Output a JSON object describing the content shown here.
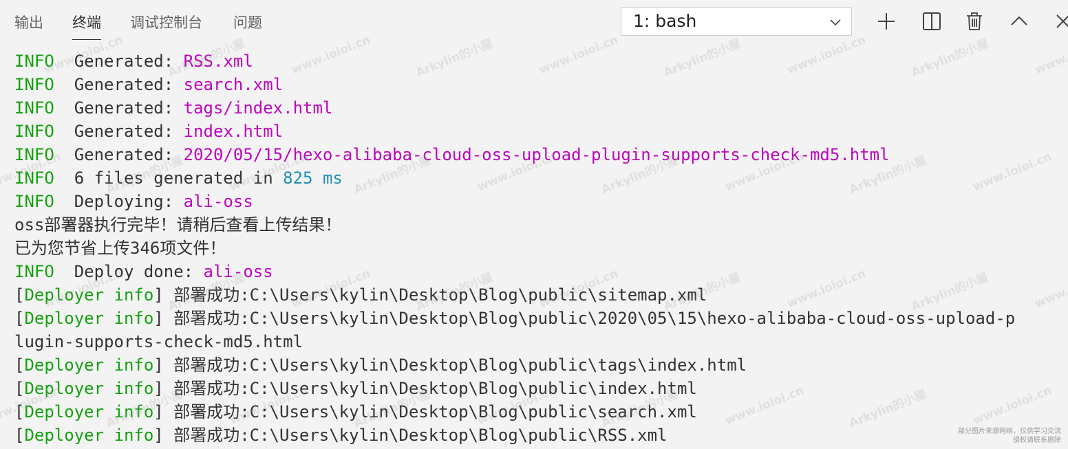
{
  "panel": {
    "tabs": [
      {
        "label": "输出",
        "active": false
      },
      {
        "label": "终端",
        "active": true
      },
      {
        "label": "调试控制台",
        "active": false
      },
      {
        "label": "问题",
        "active": false
      }
    ],
    "terminal_select": {
      "value": "1: bash"
    },
    "actions": [
      {
        "name": "new-terminal",
        "icon": "plus-icon"
      },
      {
        "name": "split-terminal",
        "icon": "split-icon"
      },
      {
        "name": "kill-terminal",
        "icon": "trash-icon"
      },
      {
        "name": "maximize-panel",
        "icon": "chevron-up-icon"
      },
      {
        "name": "close-panel",
        "icon": "close-icon"
      }
    ]
  },
  "colors": {
    "info": "#13a10e",
    "path": "#bc05bc",
    "number": "#1f8fb4",
    "text": "#333333",
    "background": "#f3f3f3"
  },
  "terminal": {
    "lines": [
      [
        {
          "t": "INFO",
          "c": "info"
        },
        {
          "t": "  Generated: ",
          "c": "plain"
        },
        {
          "t": "RSS.xml",
          "c": "path"
        }
      ],
      [
        {
          "t": "INFO",
          "c": "info"
        },
        {
          "t": "  Generated: ",
          "c": "plain"
        },
        {
          "t": "search.xml",
          "c": "path"
        }
      ],
      [
        {
          "t": "INFO",
          "c": "info"
        },
        {
          "t": "  Generated: ",
          "c": "plain"
        },
        {
          "t": "tags/index.html",
          "c": "path"
        }
      ],
      [
        {
          "t": "INFO",
          "c": "info"
        },
        {
          "t": "  Generated: ",
          "c": "plain"
        },
        {
          "t": "index.html",
          "c": "path"
        }
      ],
      [
        {
          "t": "INFO",
          "c": "info"
        },
        {
          "t": "  Generated: ",
          "c": "plain"
        },
        {
          "t": "2020/05/15/hexo-alibaba-cloud-oss-upload-plugin-supports-check-md5.html",
          "c": "path"
        }
      ],
      [
        {
          "t": "INFO",
          "c": "info"
        },
        {
          "t": "  6 files generated in ",
          "c": "plain"
        },
        {
          "t": "825 ms",
          "c": "num"
        }
      ],
      [
        {
          "t": "INFO",
          "c": "info"
        },
        {
          "t": "  Deploying: ",
          "c": "plain"
        },
        {
          "t": "ali-oss",
          "c": "path"
        }
      ],
      [
        {
          "t": "oss部署器执行完毕！请稍后查看上传结果！",
          "c": "plain"
        }
      ],
      [
        {
          "t": "已为您节省上传346项文件！",
          "c": "plain"
        }
      ],
      [
        {
          "t": "INFO",
          "c": "info"
        },
        {
          "t": "  Deploy done: ",
          "c": "plain"
        },
        {
          "t": "ali-oss",
          "c": "path"
        }
      ],
      [
        {
          "t": "[",
          "c": "plain"
        },
        {
          "t": "Deployer info",
          "c": "deployer"
        },
        {
          "t": "] 部署成功:C:\\Users\\kylin\\Desktop\\Blog\\public\\sitemap.xml",
          "c": "plain"
        }
      ],
      [
        {
          "t": "[",
          "c": "plain"
        },
        {
          "t": "Deployer info",
          "c": "deployer"
        },
        {
          "t": "] 部署成功:C:\\Users\\kylin\\Desktop\\Blog\\public\\2020\\05\\15\\hexo-alibaba-cloud-oss-upload-p",
          "c": "plain"
        }
      ],
      [
        {
          "t": "lugin-supports-check-md5.html",
          "c": "plain"
        }
      ],
      [
        {
          "t": "[",
          "c": "plain"
        },
        {
          "t": "Deployer info",
          "c": "deployer"
        },
        {
          "t": "] 部署成功:C:\\Users\\kylin\\Desktop\\Blog\\public\\tags\\index.html",
          "c": "plain"
        }
      ],
      [
        {
          "t": "[",
          "c": "plain"
        },
        {
          "t": "Deployer info",
          "c": "deployer"
        },
        {
          "t": "] 部署成功:C:\\Users\\kylin\\Desktop\\Blog\\public\\index.html",
          "c": "plain"
        }
      ],
      [
        {
          "t": "[",
          "c": "plain"
        },
        {
          "t": "Deployer info",
          "c": "deployer"
        },
        {
          "t": "] 部署成功:C:\\Users\\kylin\\Desktop\\Blog\\public\\search.xml",
          "c": "plain"
        }
      ],
      [
        {
          "t": "[",
          "c": "plain"
        },
        {
          "t": "Deployer info",
          "c": "deployer"
        },
        {
          "t": "] 部署成功:C:\\Users\\kylin\\Desktop\\Blog\\public\\RSS.xml",
          "c": "plain"
        }
      ]
    ]
  },
  "watermark": {
    "texts": [
      "Arkylin的小屋",
      "www.ioioi.cn"
    ]
  },
  "footnote": {
    "line1": "部分图片来源网络，仅供学习交流",
    "line2": "侵权请联系删除"
  }
}
